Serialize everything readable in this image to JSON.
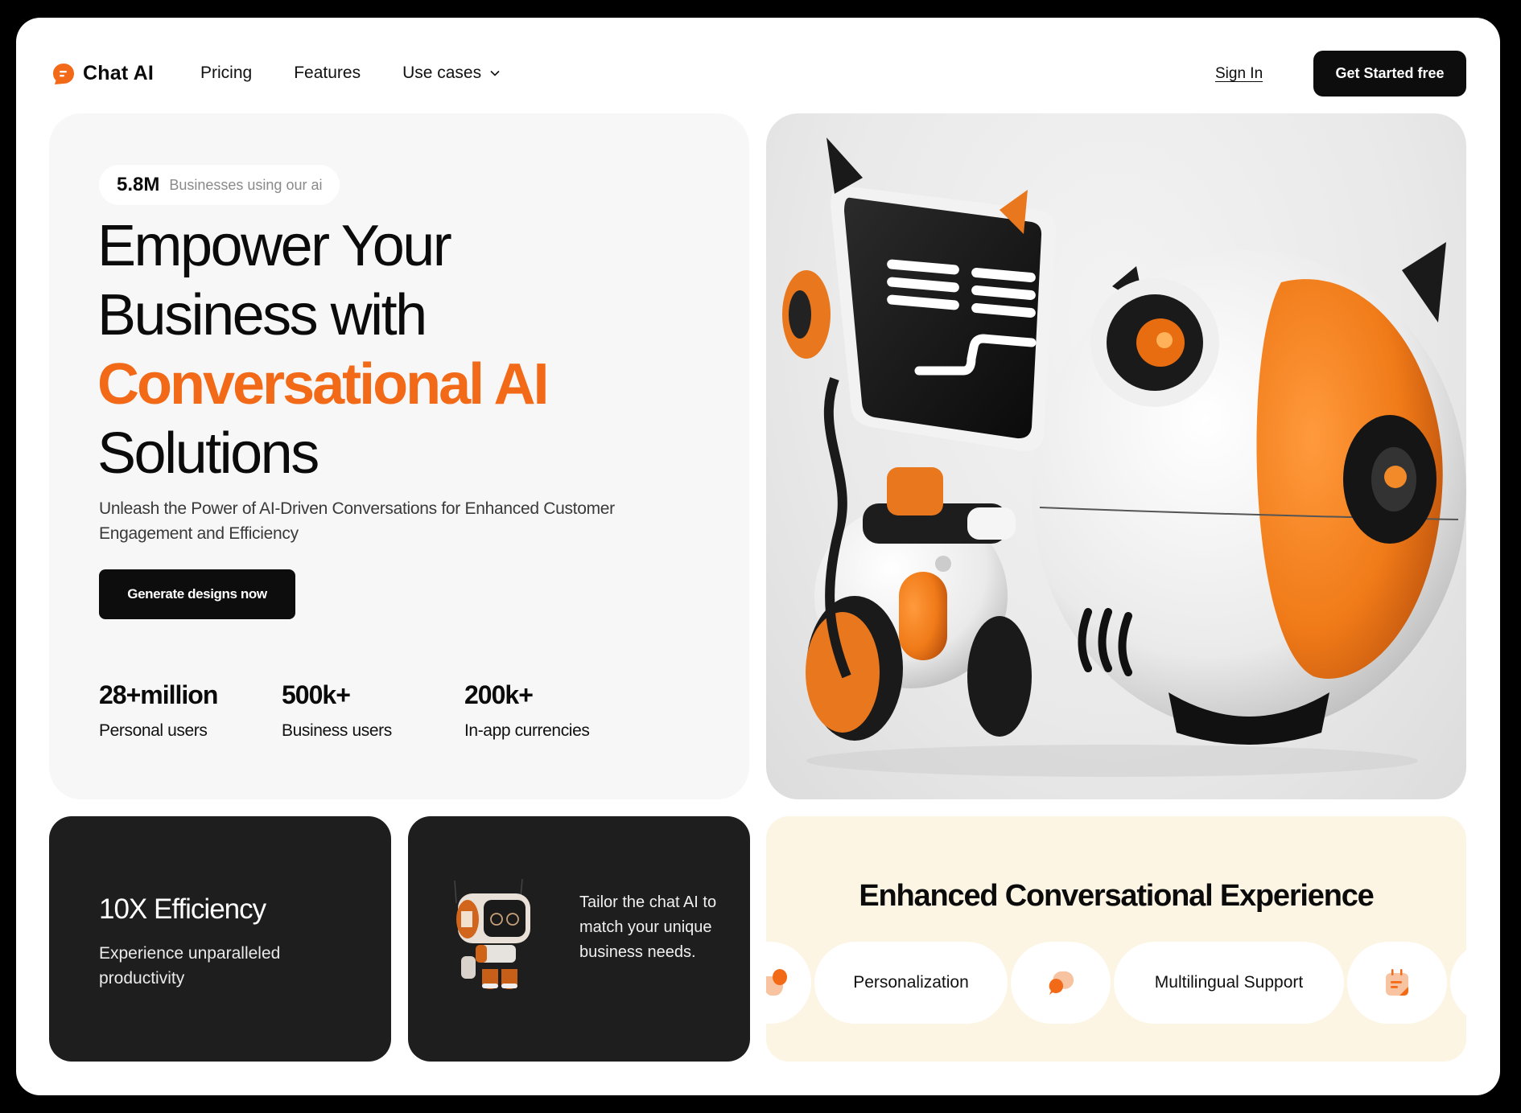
{
  "brand": {
    "name": "Chat AI",
    "accent_color": "#f26a18",
    "accent_light": "#f8c3a0",
    "dark_color": "#0d0d0d",
    "cream_color": "#fcf5e4"
  },
  "nav": {
    "links": [
      {
        "label": "Pricing"
      },
      {
        "label": "Features"
      },
      {
        "label": "Use cases",
        "has_dropdown": true
      }
    ],
    "sign_in": "Sign In",
    "cta": "Get Started free"
  },
  "hero": {
    "badge": {
      "value": "5.8M",
      "text": "Businesses using our ai"
    },
    "headline": {
      "line1": "Empower Your",
      "line2": "Business with",
      "accent": "Conversational AI",
      "line4": "Solutions"
    },
    "subtitle": "Unleash the Power of AI-Driven Conversations for Enhanced Customer Engagement and Efficiency",
    "button": "Generate designs now",
    "stats": [
      {
        "value": "28+million",
        "label": "Personal users"
      },
      {
        "value": "500k+",
        "label": "Business users"
      },
      {
        "value": "200k+",
        "label": "In-app currencies"
      }
    ],
    "image": "robot-illustration"
  },
  "cards": {
    "efficiency": {
      "title": "10X Efficiency",
      "subtitle": "Experience unparalleled productivity"
    },
    "tailor": {
      "text": "Tailor the chat AI to match your unique business needs.",
      "image": "mini-robot"
    },
    "experience": {
      "title": "Enhanced Conversational Experience",
      "chips": [
        {
          "type": "icon",
          "icon": "pie-icon"
        },
        {
          "type": "text",
          "label": "Personalization"
        },
        {
          "type": "icon",
          "icon": "chat-bubbles-icon"
        },
        {
          "type": "text",
          "label": "Multilingual Support"
        },
        {
          "type": "icon",
          "icon": "note-icon"
        },
        {
          "type": "text",
          "label": ""
        }
      ]
    }
  }
}
